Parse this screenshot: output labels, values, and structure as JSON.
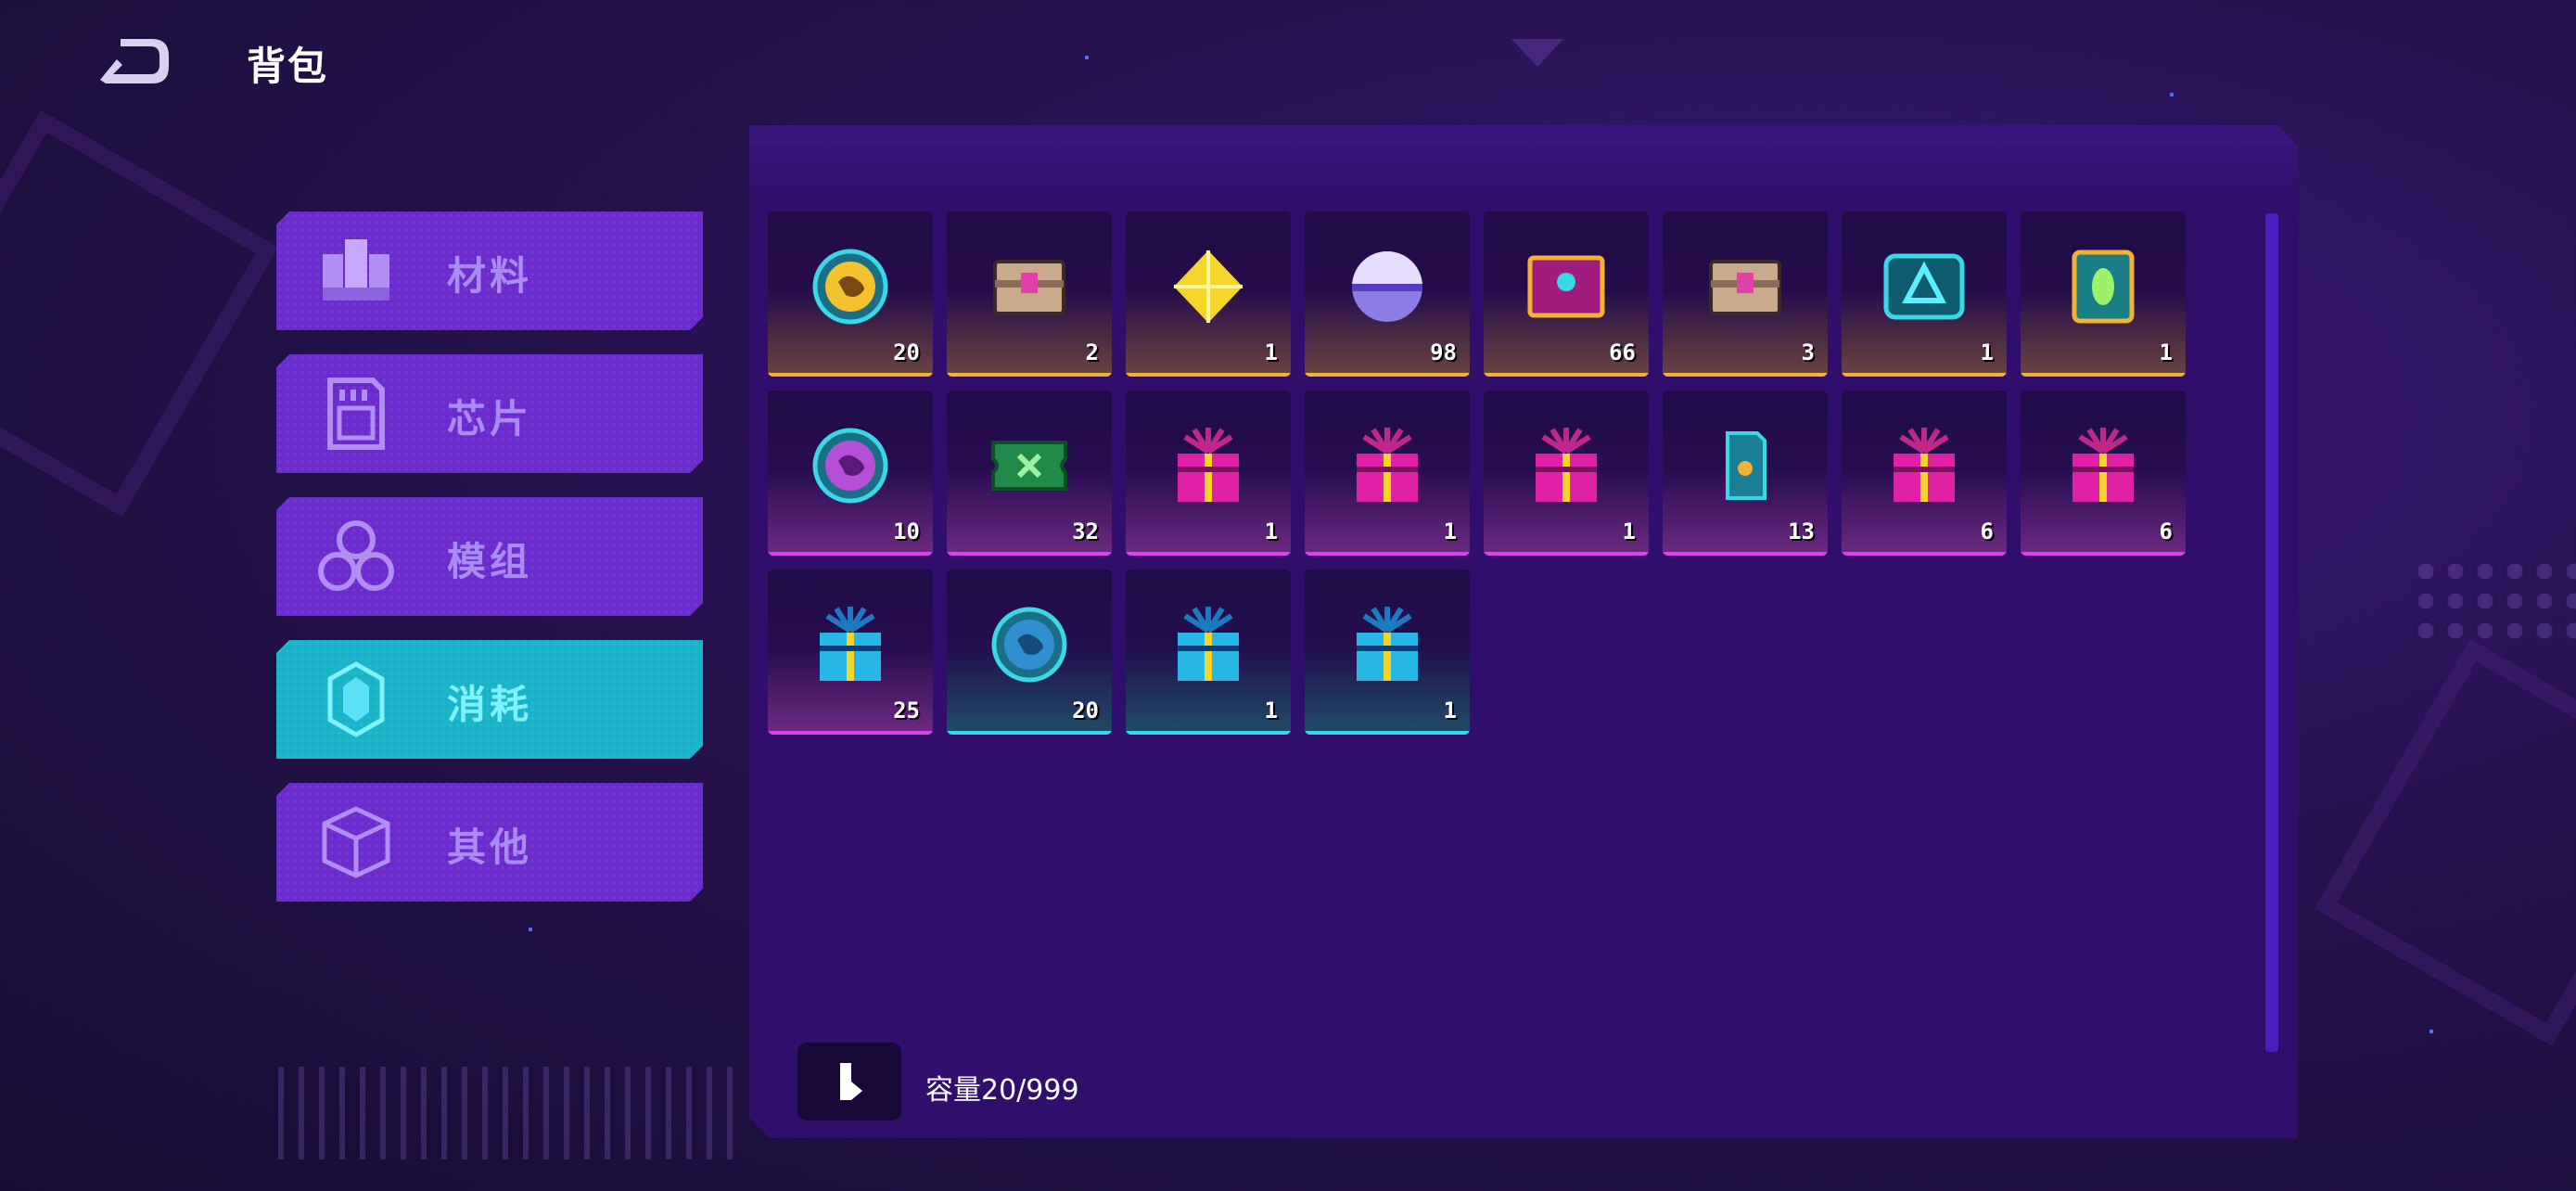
{
  "header": {
    "title": "背包",
    "back_icon": "back-arrow-icon"
  },
  "categories": [
    {
      "label": "材料",
      "icon": "materials-icon",
      "active": false
    },
    {
      "label": "芯片",
      "icon": "chip-icon",
      "active": false
    },
    {
      "label": "模组",
      "icon": "module-icon",
      "active": false
    },
    {
      "label": "消耗",
      "icon": "consumable-crystal-icon",
      "active": true
    },
    {
      "label": "其他",
      "icon": "cube-icon",
      "active": false
    }
  ],
  "items": [
    {
      "icon": "gold-planet-coin",
      "qty": "20",
      "rarity": "gold"
    },
    {
      "icon": "pink-core-chest",
      "qty": "2",
      "rarity": "gold"
    },
    {
      "icon": "yellow-diamond",
      "qty": "1",
      "rarity": "gold"
    },
    {
      "icon": "purple-orb",
      "qty": "98",
      "rarity": "gold"
    },
    {
      "icon": "magenta-treasure-chest",
      "qty": "66",
      "rarity": "gold"
    },
    {
      "icon": "pink-core-chest",
      "qty": "3",
      "rarity": "gold"
    },
    {
      "icon": "teal-triangle-chest",
      "qty": "1",
      "rarity": "gold"
    },
    {
      "icon": "energy-capsule",
      "qty": "1",
      "rarity": "gold"
    },
    {
      "icon": "purple-planet-coin",
      "qty": "10",
      "rarity": "pink"
    },
    {
      "icon": "green-ticket",
      "qty": "32",
      "rarity": "pink"
    },
    {
      "icon": "pink-gift-box",
      "qty": "1",
      "rarity": "pink"
    },
    {
      "icon": "pink-gift-box",
      "qty": "1",
      "rarity": "pink"
    },
    {
      "icon": "pink-gift-box",
      "qty": "1",
      "rarity": "pink"
    },
    {
      "icon": "teal-card",
      "qty": "13",
      "rarity": "pink"
    },
    {
      "icon": "pink-gift-box",
      "qty": "6",
      "rarity": "pink"
    },
    {
      "icon": "pink-gift-box",
      "qty": "6",
      "rarity": "pink"
    },
    {
      "icon": "blue-gift-box",
      "qty": "25",
      "rarity": "pink"
    },
    {
      "icon": "blue-planet-coin",
      "qty": "20",
      "rarity": "teal"
    },
    {
      "icon": "blue-gift-box",
      "qty": "1",
      "rarity": "teal"
    },
    {
      "icon": "blue-gift-box",
      "qty": "1",
      "rarity": "teal"
    }
  ],
  "footer": {
    "capacity_label": "容量20/999",
    "sort_icon": "sort-icon"
  },
  "colors": {
    "active_tab": "#19b4c9",
    "tab": "#6a2ccc",
    "panel": "#300f6c",
    "gold": "#f3b234",
    "pink": "#e040e8",
    "teal": "#38d8e8"
  }
}
